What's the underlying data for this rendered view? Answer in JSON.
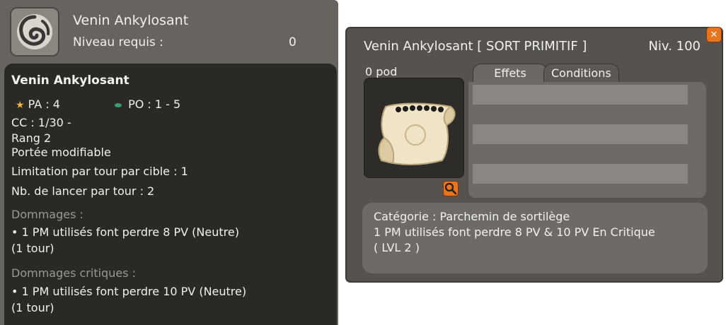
{
  "tooltip": {
    "spell_name": "Venin Ankylosant",
    "level_required_label": "Niveau requis :",
    "level_required_value": "0",
    "details": {
      "name": "Venin Ankylosant",
      "pa": "PA : 4",
      "po": "PO : 1 - 5",
      "cc": "CC : 1/30 -",
      "rank": "Rang 2",
      "range_modifiable": "Portée modifiable",
      "limit_per_target": "Limitation par tour par cible : 1",
      "casts_per_turn": "Nb. de lancer par tour : 2",
      "damage_header": "Dommages :",
      "damage_line1": "• 1 PM utilisés font perdre 8 PV (Neutre)",
      "damage_line2": "(1 tour)",
      "crit_header": "Dommages critiques :",
      "crit_line1": "• 1 PM utilisés font perdre 10 PV (Neutre)",
      "crit_line2": "(1 tour)"
    }
  },
  "item_window": {
    "title": "Venin Ankylosant [ SORT PRIMITIF ]",
    "level": "Niv. 100",
    "close_icon": "close-icon",
    "weight": "0 pod",
    "zoom_icon": "magnifier-icon",
    "tabs": [
      "Effets",
      "Conditions"
    ],
    "description": {
      "category": "Catégorie : Parchemin de sortilège",
      "effect": "1 PM utilisés font perdre 8 PV & 10 PV En Critique",
      "level": "( LVL 2 )"
    }
  },
  "colors": {
    "accent_orange": "#e7751f",
    "panel_dark": "#2b2926",
    "panel_grey": "#676460"
  }
}
